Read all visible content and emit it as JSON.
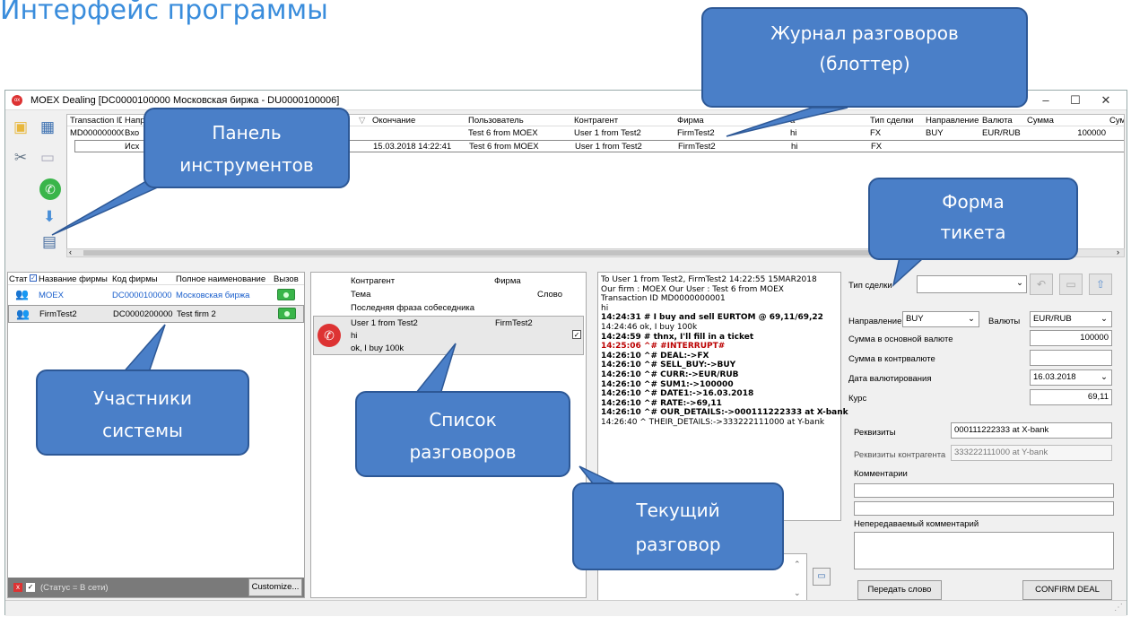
{
  "heading": "Интерфейс программы",
  "window": {
    "title": "MOEX Dealing [DC0000100000 Московская биржа - DU0000100006]"
  },
  "journal": {
    "headers": [
      "Transaction ID",
      "Напр",
      "Окончание",
      "Пользователь",
      "Контрагент",
      "Фирма",
      "a",
      "Тип сделки",
      "Направление",
      "Валюта",
      "Сумма",
      "Сумм"
    ],
    "rows": [
      [
        "MD000000000",
        "Вхо",
        "",
        "Test 6 from MOEX",
        "User 1 from Test2",
        "FirmTest2",
        "hi",
        "FX",
        "BUY",
        "EUR/RUB",
        "100000"
      ],
      [
        "",
        "Исх",
        "15.03.2018 14:22:41",
        "Test 6 from MOEX",
        "User 1 from Test2",
        "FirmTest2",
        "hi",
        "FX",
        "",
        "",
        ""
      ]
    ]
  },
  "members": {
    "headers": [
      "Стат",
      "Название фирмы",
      "Код фирмы",
      "Полное наименование",
      "Вызов"
    ],
    "rows": [
      {
        "name": "MOEX",
        "code": "DC0000100000",
        "full": "Московская биржа"
      },
      {
        "name": "FirmTest2",
        "code": "DC0000200000",
        "full": "Test firm 2"
      }
    ],
    "footer_text": "(Статус = В сети)",
    "customize_label": "Customize..."
  },
  "conversations": {
    "h_counterparty": "Контрагент",
    "h_firm": "Фирма",
    "h_topic": "Тема",
    "h_word": "Слово",
    "h_last": "Последняя фраза собеседника",
    "item": {
      "who": "User 1 from Test2",
      "firm": "FirmTest2",
      "topic": "hi",
      "last": "ok, I buy 100k"
    }
  },
  "chat": {
    "lines": [
      {
        "t": "To User 1 from Test2, FirmTest2 14:22:55 15MAR2018",
        "b": false
      },
      {
        "t": "Our firm : MOEX Our User : Test 6 from MOEX",
        "b": false
      },
      {
        "t": "Transaction ID MD0000000001",
        "b": false
      },
      {
        "t": "hi",
        "b": false
      },
      {
        "t": "14:24:31  # I buy and sell EURTOM @ 69,11/69,22",
        "b": true
      },
      {
        "t": "14:24:46   ok, I buy 100k",
        "b": false
      },
      {
        "t": "14:24:59  # thnx, I'll fill in a ticket",
        "b": true
      },
      {
        "t": "14:25:06 ^# #INTERRUPT#",
        "b": true,
        "red": true
      },
      {
        "t": "14:26:10 ^# DEAL:->FX",
        "b": true
      },
      {
        "t": "14:26:10 ^# SELL_BUY:->BUY",
        "b": true
      },
      {
        "t": "14:26:10 ^# CURR:->EUR/RUB",
        "b": true
      },
      {
        "t": "14:26:10 ^# SUM1:->100000",
        "b": true
      },
      {
        "t": "14:26:10 ^# DATE1:->16.03.2018",
        "b": true
      },
      {
        "t": "14:26:10 ^# RATE:->69,11",
        "b": true
      },
      {
        "t": "14:26:10 ^# OUR_DETAILS:->000111222333 at X-bank",
        "b": true
      },
      {
        "t": "14:26:40 ^ THEIR_DETAILS:->333222111000 at Y-bank",
        "b": false
      }
    ]
  },
  "ticket": {
    "deal_type_label": "Тип сделки",
    "direction_label": "Направление",
    "direction_value": "BUY",
    "currency_label": "Валюты",
    "currency_value": "EUR/RUB",
    "base_sum_label": "Сумма в основной валюте",
    "base_sum_value": "100000",
    "counter_sum_label": "Сумма в контрвалюте",
    "value_date_label": "Дата валютирования",
    "value_date_value": "16.03.2018",
    "rate_label": "Курс",
    "rate_value": "69,11",
    "details_label": "Реквизиты",
    "details_value": "000111222333 at X-bank",
    "cp_details_label": "Реквизиты контрагента",
    "cp_details_value": "333222111000 at Y-bank",
    "comments_label": "Комментарии",
    "private_comment_label": "Непередаваемый комментарий",
    "pass_word_label": "Передать слово",
    "confirm_label": "CONFIRM DEAL"
  },
  "callouts": {
    "journal": "Журнал разговоров (блоттер)",
    "toolbar": "Панель инструментов",
    "ticket": "Форма тикета",
    "members": "Участники системы",
    "list": "Список разговоров",
    "current": "Текущий разговор"
  },
  "colors": {
    "callout": "#4a7fc8",
    "heading": "#3a8ddc",
    "link": "#1a5fcc",
    "call_green": "#3ab54a"
  }
}
